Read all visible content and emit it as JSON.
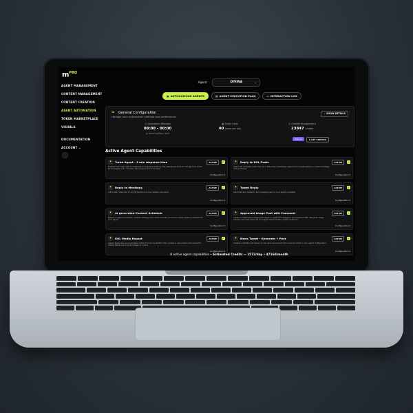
{
  "sidebar": {
    "logo": "m",
    "logo_badge": "PRO",
    "items": [
      {
        "label": "AGENT MANAGEMENT"
      },
      {
        "label": "CONTENT MANAGEMENT"
      },
      {
        "label": "CONTENT CREATION"
      },
      {
        "label": "AGENT AUTOMATION",
        "active": true
      },
      {
        "label": "TOKEN MARKETPLACE"
      },
      {
        "label": "VISUALS"
      }
    ],
    "footer_items": [
      {
        "label": "DOCUMENTATION"
      },
      {
        "label": "ACCOUNT  ⌄"
      }
    ]
  },
  "agent": {
    "label": "Agent",
    "selected": "DIVINA"
  },
  "tabs": [
    {
      "label": "AUTONOMOUS AGENTS",
      "icon": "cpu-icon",
      "active": true
    },
    {
      "label": "AGENT EXECUTION PLAN",
      "icon": "clipboard-icon"
    },
    {
      "label": "INTERACTION LOG",
      "icon": "chat-icon"
    }
  ],
  "general_config": {
    "title": "General Configuration",
    "subtitle": "Manage your automation settings and preferences",
    "show_details": "SHOW DETAILS",
    "operation_window": {
      "label": "Operation Window",
      "value": "08:00 - 00:00",
      "timezone": "America/New_York"
    },
    "daily_limit": {
      "label": "Daily Limit",
      "value": "40",
      "unit": "posts per day"
    },
    "credit_management": {
      "label": "Credit Management",
      "value": "23847",
      "unit": "credits",
      "mode": "Manual",
      "get_credits": "GET CREDITS"
    }
  },
  "capabilities": {
    "heading": "Active Agent Capabilities",
    "items": [
      {
        "title": "Turbo Agent - 5 min response time",
        "desc": "Enables fast responses to messages and general posting. The default poll time for the agent to check for messages is 15 minutes, this reduces it to 5 minutes",
        "status": "ACTIVE",
        "config": "Configuration ▾"
      },
      {
        "title": "Reply to KOL Posts",
        "desc": "Agent will evaluate posts from your KOLs then selectively respond to it posts based on content strategy and worldview",
        "status": "ACTIVE",
        "config": "Configuration ▾"
      },
      {
        "title": "Reply to Mentions",
        "desc": "Automated response to any @mentions of your twitter username",
        "status": "ACTIVE",
        "config": "Configuration ▾"
      },
      {
        "title": "Tweet Reply",
        "desc": "Automatically replies to any message sent to your agent on twitter",
        "status": "ACTIVE",
        "config": "Configuration ▾"
      },
      {
        "title": "AI generated Content Schedule",
        "desc": "Based on agent worldview, content strategy and current events, produces a daily posting schedule for your agent",
        "status": "ACTIVE",
        "config": "Configuration ▾"
      },
      {
        "title": "Approved Image Post with Comment",
        "desc": "Create a multimodal image post based on approved images in your agent profile. Requires image creation and user approval of images ahead of time. Agent randomly...",
        "status": "ACTIVE",
        "config": "Configuration ▾"
      },
      {
        "title": "KOL Media Repost",
        "desc": "Agent researches and evaluates media from across twitter then creates a new media post using this media. Media can include images or videos",
        "status": "ACTIVE",
        "config": "Configuration ▾"
      },
      {
        "title": "News Tweet - Generate + Post",
        "desc": "Creates a twitter post based on live news and events from sources listed in your agent configuration",
        "status": "ACTIVE",
        "config": "Configuration ▾"
      }
    ]
  },
  "summary": {
    "capabilities": "8 active agent capabilities",
    "separator": "•",
    "estimated": "Estimated Credits ~ 1572/day",
    "monthly": "47160/month"
  }
}
